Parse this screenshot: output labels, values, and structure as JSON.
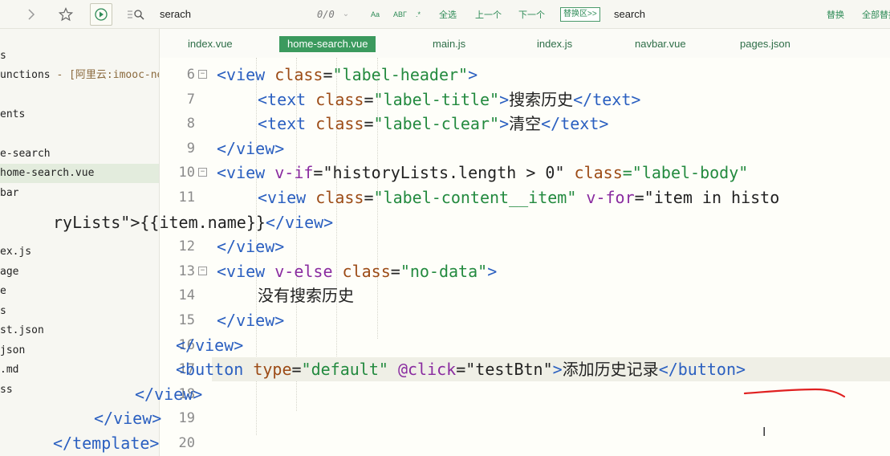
{
  "toolbar": {
    "find_value": "serach",
    "match_count": "0/0",
    "case_toggle": "Aa",
    "word_toggle": "ΑΒΓ",
    "regex_toggle": ".*",
    "select_all": "全选",
    "prev": "上一个",
    "next": "下一个",
    "replace_toggle": "替换区>>",
    "replace_value": "search",
    "replace": "替换",
    "replace_all": "全部替换"
  },
  "sidebar": {
    "items": [
      {
        "label": "s"
      },
      {
        "label": "unctions",
        "suffix": " - [阿里云:imooc-news"
      },
      {
        "label": "ents"
      },
      {
        "label": "e-search"
      },
      {
        "label": "home-search.vue",
        "selected": true
      },
      {
        "label": "bar"
      },
      {
        "label": "ex.js"
      },
      {
        "label": "age"
      },
      {
        "label": "e"
      },
      {
        "label": "s"
      },
      {
        "label": "st.json"
      },
      {
        "label": "json"
      },
      {
        "label": ".md"
      },
      {
        "label": "ss"
      }
    ]
  },
  "tabs": [
    {
      "label": "index.vue"
    },
    {
      "label": "home-search.vue",
      "active": true
    },
    {
      "label": "main.js"
    },
    {
      "label": "index.js"
    },
    {
      "label": "navbar.vue"
    },
    {
      "label": "pages.json"
    }
  ],
  "code": {
    "lines": [
      {
        "n": "6",
        "fold": true,
        "tokens": [
          {
            "t": "<view ",
            "c": "tag"
          },
          {
            "t": "class",
            "c": "attr"
          },
          {
            "t": "=",
            "c": "txt"
          },
          {
            "t": "\"label-header\"",
            "c": "str"
          },
          {
            "t": ">",
            "c": "tag"
          }
        ]
      },
      {
        "n": "7",
        "fold": false,
        "tokens": [
          {
            "t": "<text ",
            "c": "tag"
          },
          {
            "t": "class",
            "c": "attr"
          },
          {
            "t": "=",
            "c": "txt"
          },
          {
            "t": "\"label-title\"",
            "c": "str"
          },
          {
            "t": ">",
            "c": "tag"
          },
          {
            "t": "搜索历史",
            "c": "txt"
          },
          {
            "t": "</text>",
            "c": "tag"
          }
        ]
      },
      {
        "n": "8",
        "fold": false,
        "tokens": [
          {
            "t": "<text ",
            "c": "tag"
          },
          {
            "t": "class",
            "c": "attr"
          },
          {
            "t": "=",
            "c": "txt"
          },
          {
            "t": "\"label-clear\"",
            "c": "str"
          },
          {
            "t": ">",
            "c": "tag"
          },
          {
            "t": "清空",
            "c": "txt"
          },
          {
            "t": "</text>",
            "c": "tag"
          }
        ]
      },
      {
        "n": "9",
        "fold": false,
        "tokens": [
          {
            "t": "</view>",
            "c": "tag"
          }
        ]
      },
      {
        "n": "10",
        "fold": true,
        "tokens": [
          {
            "t": "<view ",
            "c": "tag"
          },
          {
            "t": "v-if",
            "c": "dir"
          },
          {
            "t": "=",
            "c": "txt"
          },
          {
            "t": "\"historyLists.length > 0\" ",
            "c": "txt"
          },
          {
            "t": "class",
            "c": "attr"
          },
          {
            "t": "=\"label-body\"",
            "c": "str"
          }
        ]
      },
      {
        "n": "11",
        "fold": false,
        "tokens": [
          {
            "t": "<view ",
            "c": "tag"
          },
          {
            "t": "class",
            "c": "attr"
          },
          {
            "t": "=",
            "c": "txt"
          },
          {
            "t": "\"label-content__item\" ",
            "c": "str"
          },
          {
            "t": "v-for",
            "c": "dir"
          },
          {
            "t": "=\"item in histo",
            "c": "txt"
          }
        ]
      },
      {
        "n": "",
        "fold": false,
        "tokens": [
          {
            "t": "ryLists\">{{item.name}}",
            "c": "txt"
          },
          {
            "t": "</view>",
            "c": "tag"
          }
        ]
      },
      {
        "n": "12",
        "fold": false,
        "tokens": [
          {
            "t": "</view>",
            "c": "tag"
          }
        ]
      },
      {
        "n": "13",
        "fold": true,
        "tokens": [
          {
            "t": "<view ",
            "c": "tag"
          },
          {
            "t": "v-else ",
            "c": "dir"
          },
          {
            "t": "class",
            "c": "attr"
          },
          {
            "t": "=",
            "c": "txt"
          },
          {
            "t": "\"no-data\"",
            "c": "str"
          },
          {
            "t": ">",
            "c": "tag"
          }
        ]
      },
      {
        "n": "14",
        "fold": false,
        "tokens": [
          {
            "t": "没有搜索历史",
            "c": "txt"
          }
        ]
      },
      {
        "n": "15",
        "fold": false,
        "tokens": [
          {
            "t": "</view>",
            "c": "tag"
          }
        ]
      },
      {
        "n": "16",
        "fold": false,
        "tokens": [
          {
            "t": "</view>",
            "c": "tag"
          }
        ]
      },
      {
        "n": "17",
        "fold": false,
        "current": true,
        "tokens": [
          {
            "t": "<button ",
            "c": "tag"
          },
          {
            "t": "type",
            "c": "attr"
          },
          {
            "t": "=",
            "c": "txt"
          },
          {
            "t": "\"default\" ",
            "c": "str"
          },
          {
            "t": "@click",
            "c": "dir"
          },
          {
            "t": "=",
            "c": "txt"
          },
          {
            "t": "\"testBtn\"",
            "c": "txt"
          },
          {
            "t": ">",
            "c": "tag"
          },
          {
            "t": "添加历史记录",
            "c": "txt"
          },
          {
            "t": "</button>",
            "c": "tag"
          }
        ]
      },
      {
        "n": "18",
        "fold": false,
        "tokens": [
          {
            "t": "</view>",
            "c": "tag"
          }
        ]
      },
      {
        "n": "19",
        "fold": false,
        "tokens": [
          {
            "t": "</view>",
            "c": "tag"
          }
        ]
      },
      {
        "n": "20",
        "fold": false,
        "tokens": [
          {
            "t": "</template>",
            "c": "tag"
          }
        ]
      }
    ]
  }
}
